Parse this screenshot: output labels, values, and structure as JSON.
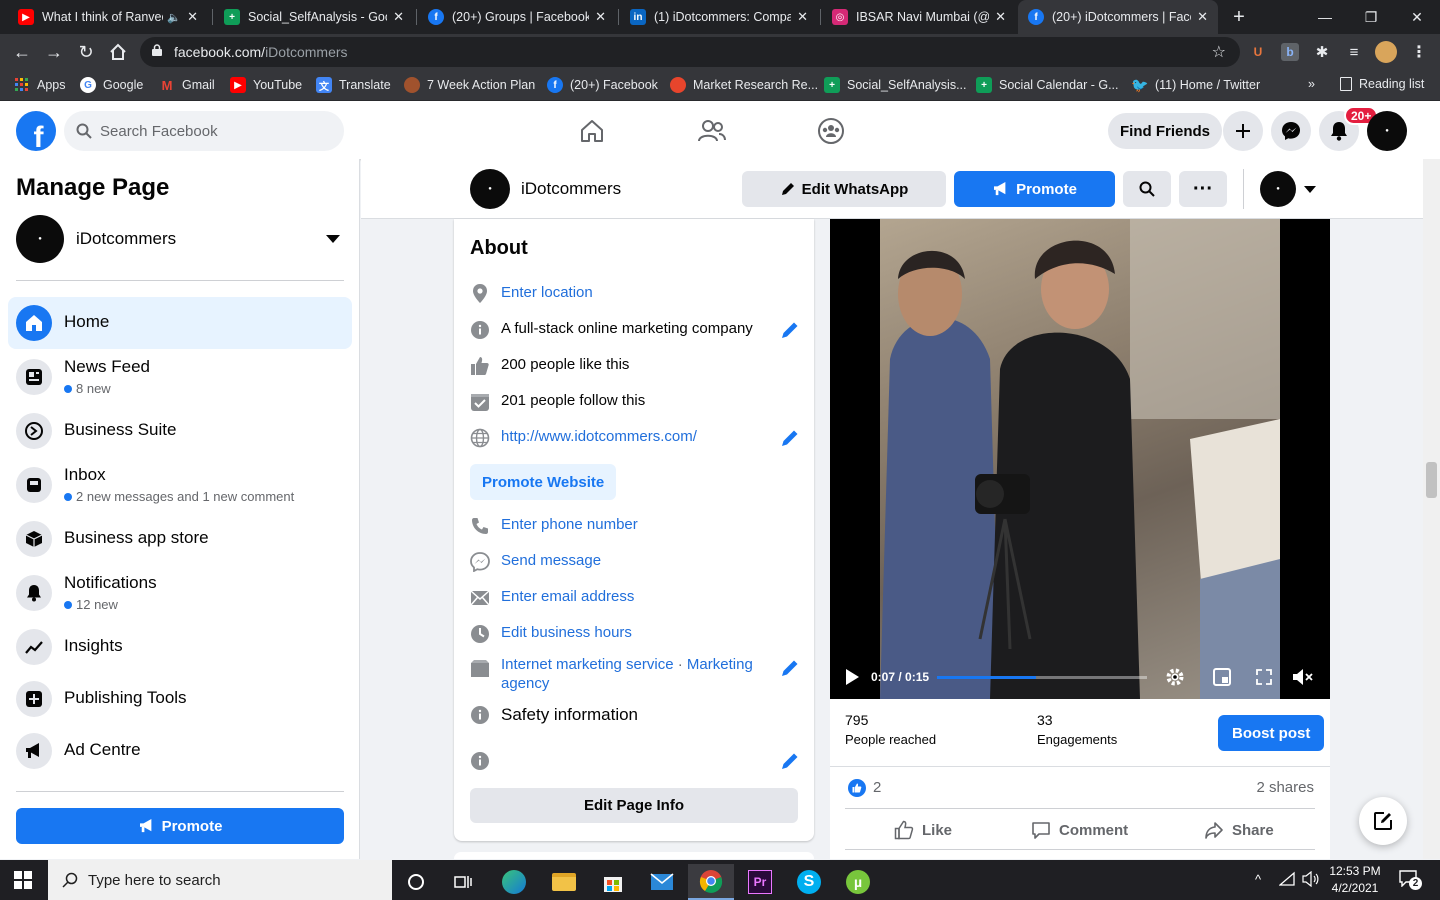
{
  "browser": {
    "tabs": [
      {
        "title": "What I think of Ranveer...",
        "favicon": "youtube-icon",
        "color": "#ff0000",
        "active": false
      },
      {
        "title": "Social_SelfAnalysis - Google...",
        "favicon": "sheets-icon",
        "color": "#0f9d58",
        "active": false
      },
      {
        "title": "(20+) Groups | Facebook",
        "favicon": "facebook-icon",
        "color": "#1877f2",
        "active": false
      },
      {
        "title": "(1) iDotcommers: Company...",
        "favicon": "linkedin-icon",
        "color": "#0a66c2",
        "active": false
      },
      {
        "title": "IBSAR Navi Mumbai (@ibsar...",
        "favicon": "instagram-icon",
        "color": "#d62976",
        "active": false
      },
      {
        "title": "(20+) iDotcommers | Face...",
        "favicon": "facebook-icon",
        "color": "#1877f2",
        "active": true
      }
    ],
    "url_domain": "facebook.com/",
    "url_path": "iDotcommers",
    "bookmarks": [
      {
        "label": "Apps",
        "icon": "apps-grid-icon",
        "color": "#4285f4"
      },
      {
        "label": "Google",
        "icon": "google-icon",
        "color": "#4285f4"
      },
      {
        "label": "Gmail",
        "icon": "gmail-icon",
        "color": "#ea4335"
      },
      {
        "label": "YouTube",
        "icon": "youtube-icon",
        "color": "#ff0000"
      },
      {
        "label": "Translate",
        "icon": "translate-icon",
        "color": "#4285f4"
      },
      {
        "label": "7 Week Action Plan",
        "icon": "profile-icon",
        "color": "#a0522d"
      },
      {
        "label": "(20+) Facebook",
        "icon": "facebook-icon",
        "color": "#1877f2"
      },
      {
        "label": "Market Research Re...",
        "icon": "flame-icon",
        "color": "#e8452c"
      },
      {
        "label": "Social_SelfAnalysis...",
        "icon": "sheets-icon",
        "color": "#0f9d58"
      },
      {
        "label": "Social Calendar - G...",
        "icon": "sheets-icon",
        "color": "#0f9d58"
      },
      {
        "label": "(11) Home / Twitter",
        "icon": "twitter-icon",
        "color": "#1da1f2"
      }
    ],
    "reading_list": "Reading list"
  },
  "fb": {
    "search_placeholder": "Search Facebook",
    "find_friends": "Find Friends",
    "notif_badge": "20+",
    "brand_color": "#1877f2"
  },
  "sidebar": {
    "title": "Manage Page",
    "page_name": "iDotcommers",
    "items": [
      {
        "label": "Home",
        "sub": "",
        "icon": "home-icon",
        "active": true
      },
      {
        "label": "News Feed",
        "sub": "8 new",
        "icon": "news-feed-icon",
        "active": false
      },
      {
        "label": "Business Suite",
        "sub": "",
        "icon": "business-suite-icon",
        "active": false
      },
      {
        "label": "Inbox",
        "sub": "2 new messages and 1 new comment",
        "icon": "inbox-icon",
        "active": false
      },
      {
        "label": "Business app store",
        "sub": "",
        "icon": "box-icon",
        "active": false
      },
      {
        "label": "Notifications",
        "sub": "12 new",
        "icon": "bell-icon",
        "active": false
      },
      {
        "label": "Insights",
        "sub": "",
        "icon": "insights-icon",
        "active": false
      },
      {
        "label": "Publishing Tools",
        "sub": "",
        "icon": "publishing-tools-icon",
        "active": false
      },
      {
        "label": "Ad Centre",
        "sub": "",
        "icon": "megaphone-icon",
        "active": false
      }
    ],
    "promote": "Promote"
  },
  "pagebar": {
    "page_name": "iDotcommers",
    "edit_whatsapp": "Edit WhatsApp",
    "promote": "Promote"
  },
  "about": {
    "title": "About",
    "location": "Enter location",
    "description": "A full-stack online marketing company",
    "likes": "200 people like this",
    "follows": "201 people follow this",
    "website": "http://www.idotcommers.com/",
    "promote_website": "Promote Website",
    "phone": "Enter phone number",
    "message": "Send message",
    "email": "Enter email address",
    "hours": "Edit business hours",
    "category_1": "Internet marketing service",
    "category_sep": " · ",
    "category_2": "Marketing",
    "category_3": "agency",
    "safety": "Safety information",
    "edit_button": "Edit Page Info"
  },
  "post": {
    "video_time": "0:07 / 0:15",
    "progress_fraction": 0.47,
    "reached_count": "795",
    "reached_label": "People reached",
    "engagements_count": "33",
    "engagements_label": "Engagements",
    "boost": "Boost post",
    "reactions_count": "2",
    "shares": "2 shares",
    "like": "Like",
    "comment": "Comment",
    "share": "Share"
  },
  "taskbar": {
    "search_placeholder": "Type here to search",
    "time": "12:53 PM",
    "date": "4/2/2021",
    "notif_count": "2"
  }
}
